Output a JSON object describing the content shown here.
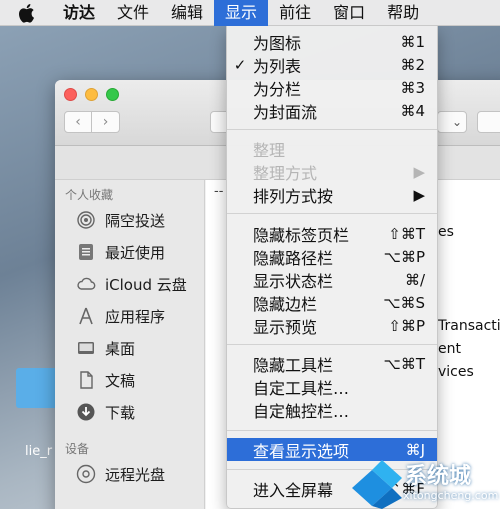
{
  "menubar": {
    "app_name": "访达",
    "menus": [
      "文件",
      "编辑",
      "显示",
      "前往",
      "窗口",
      "帮助"
    ],
    "active_menu": "显示"
  },
  "view_menu": {
    "items": [
      {
        "label": "为图标",
        "shortcut": "⌘1",
        "checked": false,
        "disabled": false
      },
      {
        "label": "为列表",
        "shortcut": "⌘2",
        "checked": true,
        "disabled": false
      },
      {
        "label": "为分栏",
        "shortcut": "⌘3",
        "checked": false,
        "disabled": false
      },
      {
        "label": "为封面流",
        "shortcut": "⌘4",
        "checked": false,
        "disabled": false
      },
      {
        "label": "整理",
        "shortcut": "",
        "checked": false,
        "disabled": true
      },
      {
        "label": "整理方式",
        "shortcut": "▶",
        "checked": false,
        "disabled": true
      },
      {
        "label": "排列方式按",
        "shortcut": "▶",
        "checked": false,
        "disabled": false
      },
      {
        "label": "隐藏标签页栏",
        "shortcut": "⇧⌘T",
        "checked": false,
        "disabled": false
      },
      {
        "label": "隐藏路径栏",
        "shortcut": "⌥⌘P",
        "checked": false,
        "disabled": false
      },
      {
        "label": "显示状态栏",
        "shortcut": "⌘/",
        "checked": false,
        "disabled": false
      },
      {
        "label": "隐藏边栏",
        "shortcut": "⌥⌘S",
        "checked": false,
        "disabled": false
      },
      {
        "label": "显示预览",
        "shortcut": "⇧⌘P",
        "checked": false,
        "disabled": false
      },
      {
        "label": "隐藏工具栏",
        "shortcut": "⌥⌘T",
        "checked": false,
        "disabled": false
      },
      {
        "label": "自定工具栏…",
        "shortcut": "",
        "checked": false,
        "disabled": false
      },
      {
        "label": "自定触控栏…",
        "shortcut": "",
        "checked": false,
        "disabled": false
      },
      {
        "label": "查看显示选项",
        "shortcut": "⌘J",
        "checked": false,
        "disabled": false,
        "highlighted": true
      },
      {
        "label": "进入全屏幕",
        "shortcut": "⌃⌘F",
        "checked": false,
        "disabled": false
      }
    ]
  },
  "sidebar": {
    "favorites_header": "个人收藏",
    "favorites": [
      {
        "label": "隔空投送",
        "icon": "airdrop-icon"
      },
      {
        "label": "最近使用",
        "icon": "recents-icon"
      },
      {
        "label": "iCloud 云盘",
        "icon": "cloud-icon"
      },
      {
        "label": "应用程序",
        "icon": "applications-icon"
      },
      {
        "label": "桌面",
        "icon": "desktop-icon"
      },
      {
        "label": "文稿",
        "icon": "documents-icon"
      },
      {
        "label": "下载",
        "icon": "download-icon"
      }
    ],
    "devices_header": "设备",
    "devices": [
      {
        "label": "远程光盘",
        "icon": "remote-disc-icon"
      }
    ]
  },
  "content": {
    "column_header_fragment": "--",
    "row_fragments": [
      "es",
      "Transacti",
      "ent",
      "vices"
    ]
  },
  "toolbar": {
    "view_dropdown_fragment": "⌄"
  },
  "desktop": {
    "file_label": "lie_r"
  },
  "watermark": {
    "title": "系统城",
    "url": "xitongcheng.com"
  },
  "colors": {
    "accent": "#2d6ed8",
    "menubar": "#e9e9ea",
    "disabled_text": "#b5b5b5"
  }
}
